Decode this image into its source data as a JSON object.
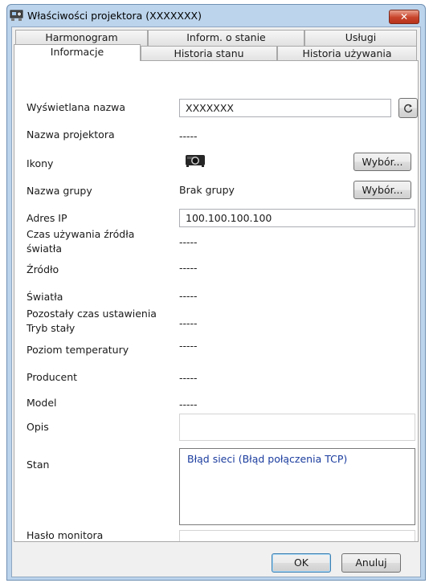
{
  "window": {
    "title": "Właściwości projektora (XXXXXXX)",
    "close_label": "✕"
  },
  "tabs": {
    "row1": [
      "Harmonogram",
      "Inform. o stanie",
      "Usługi"
    ],
    "row2": [
      "Informacje",
      "Historia stanu",
      "Historia używania"
    ],
    "active": "Informacje"
  },
  "info": {
    "display_name": {
      "label": "Wyświetlana nazwa",
      "value": "XXXXXXX"
    },
    "projector_name": {
      "label": "Nazwa projektora",
      "value": "-----"
    },
    "icons": {
      "label": "Ikony",
      "button": "Wybór..."
    },
    "group_name": {
      "label": "Nazwa grupy",
      "value": "Brak grupy",
      "button": "Wybór..."
    },
    "ip_address": {
      "label": "Adres IP",
      "value": "100.100.100.100"
    },
    "light_usage_time": {
      "label": "Czas używania źródła światła",
      "value": "-----"
    },
    "source": {
      "label": "Źródło",
      "value": "-----"
    },
    "lights": {
      "label": "Światła",
      "value": "-----"
    },
    "constant_mode_time": {
      "label": "Pozostały czas ustawienia Tryb stały",
      "value": "-----"
    },
    "temperature_level": {
      "label": "Poziom temperatury",
      "value": "-----"
    },
    "manufacturer": {
      "label": "Producent",
      "value": "-----"
    },
    "model": {
      "label": "Model",
      "value": "-----"
    },
    "description": {
      "label": "Opis",
      "value": ""
    },
    "status": {
      "label": "Stan",
      "value": "Błąd sieci (Błąd połączenia TCP)"
    },
    "monitor_password": {
      "label": "Hasło monitora",
      "value": ""
    }
  },
  "footer": {
    "ok_label": "OK",
    "cancel_label": "Anuluj"
  },
  "icons": {
    "title": "projector-properties-icon",
    "refresh": "refresh-icon",
    "projector": "projector-icon"
  },
  "colors": {
    "window_frame": "#bcd4ec",
    "close_button": "#c8432b",
    "status_text": "#1a3c9e"
  }
}
